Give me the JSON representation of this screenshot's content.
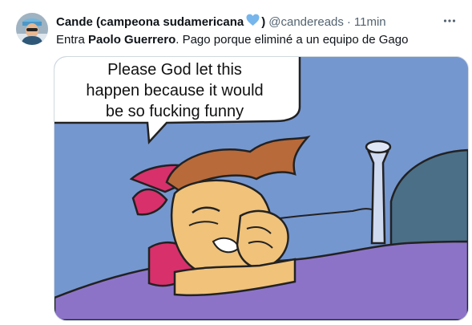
{
  "tweet": {
    "author_name": "Cande (campeona sudamericana",
    "author_name_end": ")",
    "handle": "@candereads",
    "separator": "·",
    "time": "11min",
    "text_pre": "Entra ",
    "text_bold": "Paolo Guerrero",
    "text_post": ". Pago porque eliminé a un equipo de Gago"
  },
  "media": {
    "speech_lines": [
      "Please God let this",
      "happen because it would",
      "be so fucking funny"
    ]
  },
  "icons": {
    "heart": "blue-heart-icon",
    "more": "more-options-icon",
    "avatar": "profile-avatar"
  },
  "colors": {
    "sky": "#7597d0",
    "blanket": "#8d73c8",
    "hat": "#d8306b",
    "skin": "#f0c27a",
    "hair": "#b86a3a",
    "dome": "#4b6f87",
    "heart": "#76b6ec",
    "secondary_text": "#536471"
  }
}
